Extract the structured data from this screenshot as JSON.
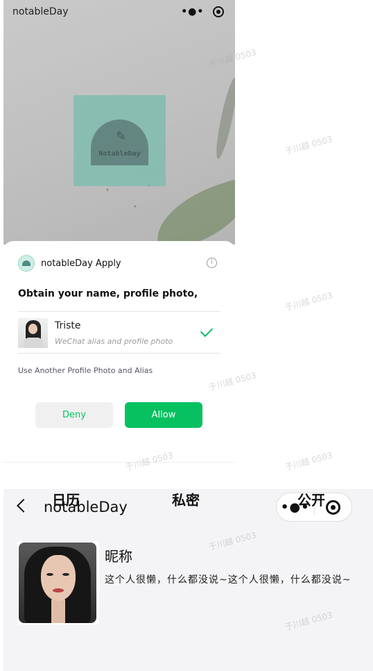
{
  "auth_screen": {
    "miniprogram_title": "notableDay",
    "logo_text": "NotableDay",
    "dialog": {
      "app_apply": "notableDay Apply",
      "obtain_text": "Obtain your name, profile photo,",
      "profile_name": "Triste",
      "profile_sub": "WeChat alias and profile photo",
      "use_another": "Use Another Profile Photo and Alias",
      "deny_label": "Deny",
      "allow_label": "Allow"
    }
  },
  "profile_screen": {
    "nav_title": "notableDay",
    "nickname": "昵称",
    "bio": "这个人很懒，什么都没说~这个人很懒，什么都没说~",
    "tabs": [
      "日历",
      "私密",
      "公开"
    ]
  },
  "watermark": "于川越 0503",
  "colors": {
    "wechat_green": "#07c160",
    "logo_teal": "#8fd9c8"
  },
  "icons": [
    "more-dots-icon",
    "target-icon",
    "pen-icon",
    "info-icon",
    "check-icon",
    "back-chevron-icon"
  ]
}
